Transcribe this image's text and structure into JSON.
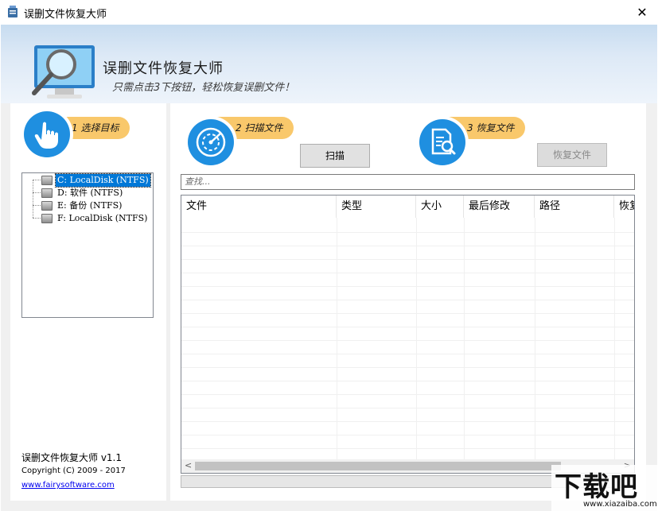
{
  "window": {
    "title": "误删文件恢复大师",
    "close_glyph": "✕"
  },
  "banner": {
    "app_name": "误删文件恢复大师",
    "slogan": "只需点击3下按钮，轻松恢复误删文件！"
  },
  "steps": [
    {
      "label": "1 选择目标",
      "icon": "hand-pointer-icon"
    },
    {
      "label": "2 扫描文件",
      "icon": "radar-scan-icon"
    },
    {
      "label": "3 恢复文件",
      "icon": "document-search-icon"
    }
  ],
  "buttons": {
    "scan": "扫描",
    "recover": "恢复文件"
  },
  "drives": [
    {
      "label": "C: LocalDisk (NTFS)",
      "selected": true
    },
    {
      "label": "D: 软件 (NTFS)",
      "selected": false
    },
    {
      "label": "E: 备份 (NTFS)",
      "selected": false
    },
    {
      "label": "F: LocalDisk (NTFS)",
      "selected": false
    }
  ],
  "search": {
    "placeholder": "查找..."
  },
  "table": {
    "columns": [
      "文件",
      "类型",
      "大小",
      "最后修改",
      "路径",
      "恢复"
    ]
  },
  "about": {
    "name_version": "误删文件恢复大师 v1.1",
    "copyright": "Copyright (C) 2009 - 2017",
    "website": "www.fairysoftware.com"
  },
  "watermark": {
    "brand": "下载吧",
    "url": "www.xiazaiba.com"
  },
  "colors": {
    "accent": "#1f8fe0",
    "tag": "#f9c86b",
    "selection": "#0078d7"
  }
}
